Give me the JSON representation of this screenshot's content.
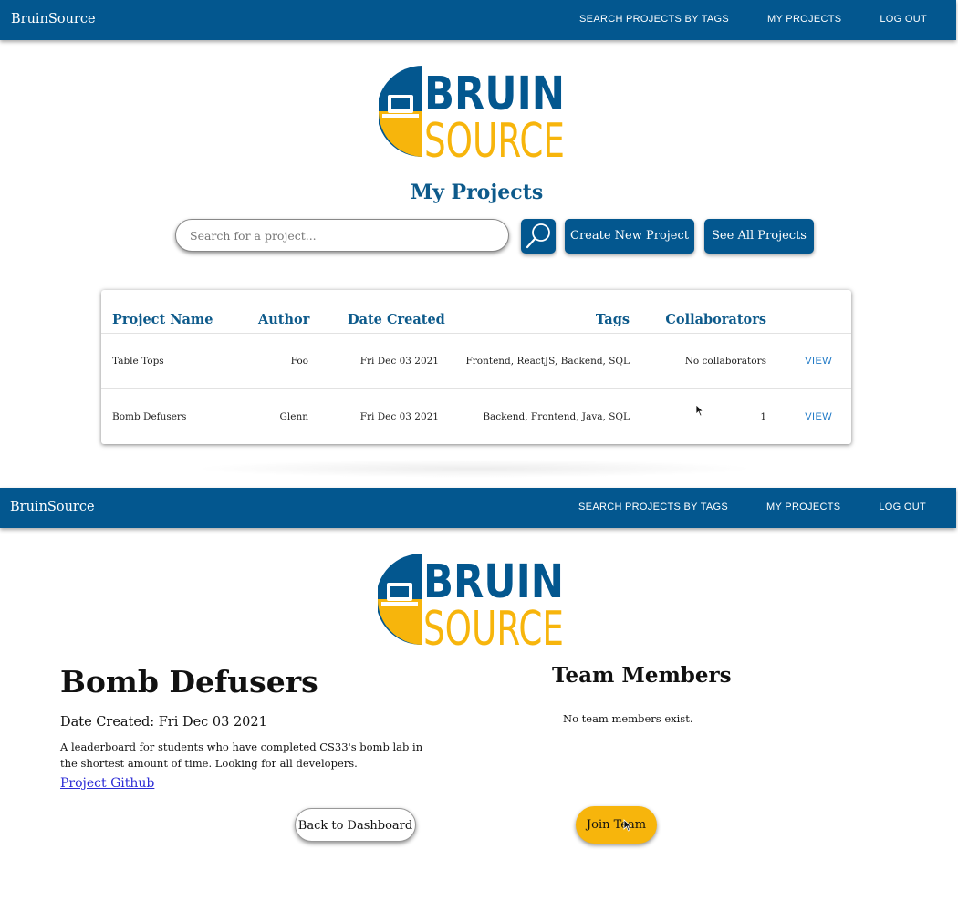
{
  "colors": {
    "primary": "#03578f",
    "accent": "#f7b50c",
    "title": "#0d5a8b",
    "link": "#1f79c6"
  },
  "nav": {
    "brand": "BruinSource",
    "links": [
      "SEARCH PROJECTS BY TAGS",
      "MY PROJECTS",
      "LOG OUT"
    ]
  },
  "logo": {
    "word1": "BRUIN",
    "word2": "SOURCE"
  },
  "my_projects": {
    "title": "My Projects",
    "search_placeholder": "Search for a project...",
    "search_icon": "magnifier-icon",
    "create_label": "Create New Project",
    "see_all_label": "See All Projects",
    "table": {
      "headers": [
        "Project Name",
        "Author",
        "Date Created",
        "Tags",
        "Collaborators"
      ],
      "rows": [
        {
          "name": "Table Tops",
          "author": "Foo",
          "date": "Fri Dec 03 2021",
          "tags": "Frontend, ReactJS, Backend, SQL",
          "collaborators": "No collaborators",
          "action": "VIEW"
        },
        {
          "name": "Bomb Defusers",
          "author": "Glenn",
          "date": "Fri Dec 03 2021",
          "tags": "Backend, Frontend, Java, SQL",
          "collaborators": "1",
          "action": "VIEW"
        }
      ]
    }
  },
  "project_detail": {
    "title": "Bomb Defusers",
    "date_created": "Date Created: Fri Dec 03 2021",
    "description": "A leaderboard for students who have completed CS33's bomb lab in the shortest amount of time. Looking for all developers.",
    "github_link": "Project Github",
    "team_heading": "Team Members",
    "no_members": "No team members exist.",
    "back_label": "Back to Dashboard",
    "join_label": "Join Team"
  }
}
